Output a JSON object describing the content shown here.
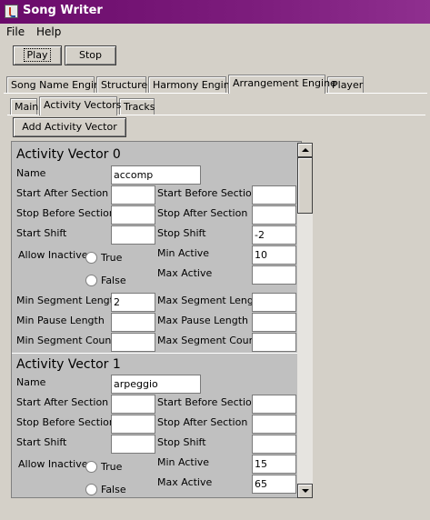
{
  "window": {
    "title": "Song Writer"
  },
  "menu": {
    "file": "File",
    "help": "Help"
  },
  "toolbar": {
    "play": "Play",
    "stop": "Stop"
  },
  "main_tabs": [
    "Song Name Engine",
    "Structure",
    "Harmony Engine",
    "Arrangement Engine",
    "Player"
  ],
  "sub_tabs": [
    "Main",
    "Activity Vectors",
    "Tracks"
  ],
  "add_vector_button": "Add Activity Vector",
  "labels": {
    "name": "Name",
    "start_after_section": "Start After Section",
    "start_before_section": "Start Before Section",
    "stop_before_section": "Stop Before Section",
    "stop_after_section": "Stop After Section",
    "start_shift": "Start Shift",
    "stop_shift": "Stop Shift",
    "allow_inactive": "Allow Inactive",
    "true": "True",
    "false": "False",
    "min_active": "Min Active",
    "max_active": "Max Active",
    "min_segment_length": "Min Segment Length",
    "max_segment_length": "Max Segment Length",
    "min_pause_length": "Min Pause Length",
    "max_pause_length": "Max Pause Length",
    "min_segment_count": "Min Segment Count",
    "max_segment_count": "Max Segment Count"
  },
  "vectors": [
    {
      "title": "Activity Vector 0",
      "name": "accomp",
      "start_after_section": "",
      "start_before_section": "",
      "stop_before_section": "",
      "stop_after_section": "",
      "start_shift": "",
      "stop_shift": "-2",
      "min_active": "10",
      "max_active": "",
      "min_segment_length": "2",
      "max_segment_length": "",
      "min_pause_length": "",
      "max_pause_length": "",
      "min_segment_count": "",
      "max_segment_count": ""
    },
    {
      "title": "Activity Vector 1",
      "name": "arpeggio",
      "start_after_section": "",
      "start_before_section": "",
      "stop_before_section": "",
      "stop_after_section": "",
      "start_shift": "",
      "stop_shift": "",
      "min_active": "15",
      "max_active": "65"
    }
  ]
}
